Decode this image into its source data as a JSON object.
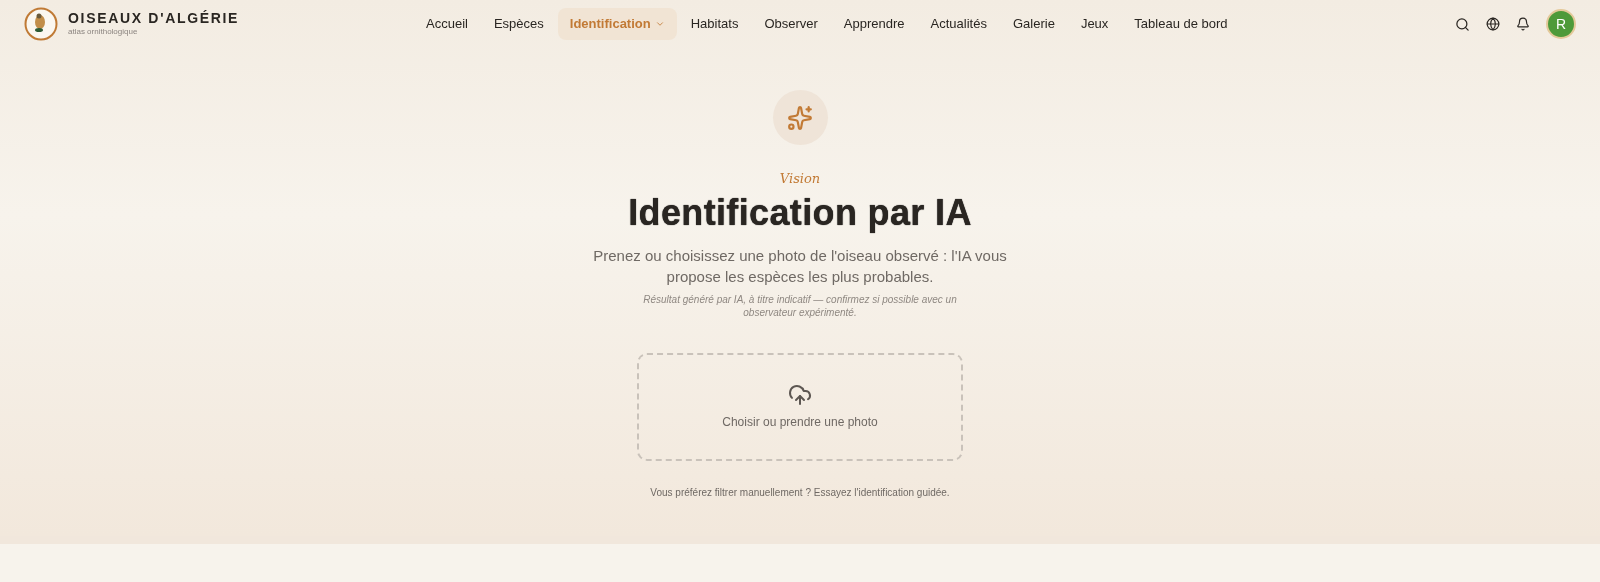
{
  "brand": {
    "title": "OISEAUX D'ALGÉRIE",
    "subtitle": "atlas ornithologique"
  },
  "nav": [
    {
      "label": "Accueil",
      "selected": false,
      "dropdown": false
    },
    {
      "label": "Espèces",
      "selected": false,
      "dropdown": false
    },
    {
      "label": "Identification",
      "selected": true,
      "dropdown": true
    },
    {
      "label": "Habitats",
      "selected": false,
      "dropdown": false
    },
    {
      "label": "Observer",
      "selected": false,
      "dropdown": false
    },
    {
      "label": "Apprendre",
      "selected": false,
      "dropdown": false
    },
    {
      "label": "Actualités",
      "selected": false,
      "dropdown": false
    },
    {
      "label": "Galerie",
      "selected": false,
      "dropdown": false
    },
    {
      "label": "Jeux",
      "selected": false,
      "dropdown": false
    },
    {
      "label": "Tableau de bord",
      "selected": false,
      "dropdown": false
    }
  ],
  "avatar": "R",
  "hero": {
    "eyebrow": "Vision",
    "title": "Identification par IA",
    "lead": "Prenez ou choisissez une photo de l'oiseau observé : l'IA vous propose les espèces les plus probables.",
    "note": "Résultat généré par IA, à titre indicatif — confirmez si possible avec un observateur expérimenté.",
    "upload": "Choisir ou prendre une photo",
    "footer": "Vous préférez filtrer manuellement ? Essayez l'identification guidée."
  }
}
